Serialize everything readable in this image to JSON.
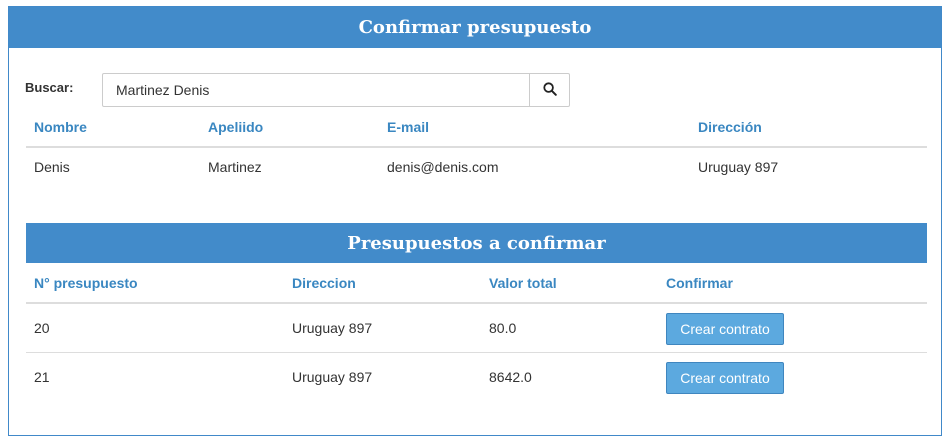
{
  "header": {
    "title": "Confirmar presupuesto"
  },
  "search": {
    "label": "Buscar:",
    "value": "Martinez Denis"
  },
  "client_table": {
    "columns": [
      "Nombre",
      "Apeliido",
      "E-mail",
      "Dirección"
    ],
    "row": {
      "nombre": "Denis",
      "apellido": "Martinez",
      "email": "denis@denis.com",
      "direccion": "Uruguay 897"
    }
  },
  "budgets": {
    "title": "Presupuestos a confirmar",
    "columns": [
      "N° presupuesto",
      "Direccion",
      "Valor total",
      "Confirmar"
    ],
    "rows": [
      {
        "numero": "20",
        "direccion": "Uruguay 897",
        "valor": "80.0",
        "action": "Crear contrato"
      },
      {
        "numero": "21",
        "direccion": "Uruguay 897",
        "valor": "8642.0",
        "action": "Crear contrato"
      }
    ]
  },
  "colors": {
    "primary": "#428bca",
    "header_text": "#3a87c1",
    "button": "#5ca9df"
  }
}
